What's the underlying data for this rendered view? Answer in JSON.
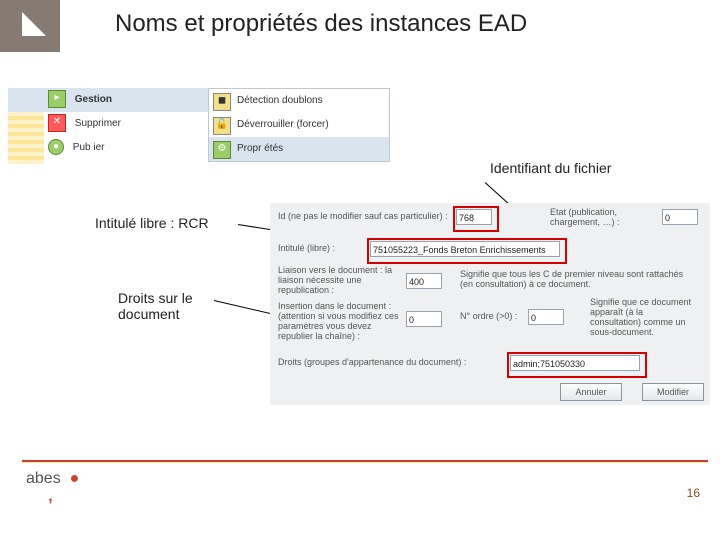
{
  "title": "Noms et propriétés des instances EAD",
  "menuA": {
    "items": [
      {
        "label": "Gestion"
      },
      {
        "label": "Supprimer"
      },
      {
        "label": "Pub ier"
      }
    ]
  },
  "menuB": {
    "items": [
      {
        "label": "Détection doublons"
      },
      {
        "label": "Déverrouiller (forcer)"
      },
      {
        "label": "Propr étés"
      }
    ]
  },
  "callouts": {
    "identifiant": "Identifiant du fichier",
    "intitule": "Intitulé libre : RCR",
    "droits": "Droits sur le\ndocument"
  },
  "dialog": {
    "id_label": "Id (ne pas le modifier sauf cas particulier) :",
    "id_value": "768",
    "etat_label": "Etat (publication,\nchargement, …) :",
    "etat_value": "0",
    "intitule_label": "Intitulé (libre) :",
    "intitule_value": "751055223_Fonds Breton Enrichissements",
    "liaison_label1": "Liaison vers le document : la\nliaison nécessite une\nrepublication :",
    "liaison_value": "400",
    "liaison_label2": "Signifie que tous les C de premier niveau sont rattachés\n(en consultation) à ce document.",
    "insertion_label": "Insertion dans le document :\n(attention si vous modifiez ces\nparamètres vous devez\nrepublier la chaîne) :",
    "insertion_value": "0",
    "ordre_label": "N° ordre (>0) :",
    "ordre_value": "0",
    "insertion_label2": "Signifie que ce document\napparaît (à la\nconsultation) comme un\nsous-document.",
    "droits_label": "Droits (groupes d'appartenance du document) :",
    "droits_value": "admin;751050330",
    "btn_annuler": "Annuler",
    "btn_modifier": "Modifier"
  },
  "footer": {
    "brand": "abes",
    "page": "16"
  }
}
